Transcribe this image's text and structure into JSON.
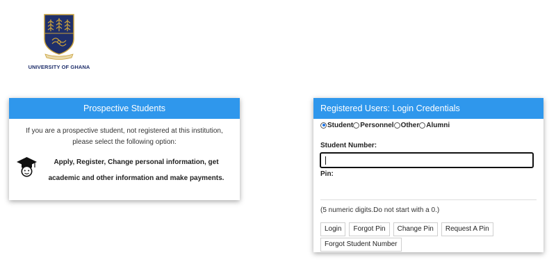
{
  "logo": {
    "university_name": "UNIVERSITY OF GHANA",
    "brand_navy": "#1f2f6b",
    "brand_gold": "#c9a13b"
  },
  "prospective": {
    "title": "Prospective Students",
    "intro": "If you are a prospective student, not registered at this institution, please select the following option:",
    "apply_text": "Apply, Register, Change personal information, get academic and other information and make payments.",
    "icon": "graduate-cap-icon"
  },
  "login": {
    "title": "Registered Users: Login Credentials",
    "user_types": [
      {
        "label": "Student",
        "checked": true
      },
      {
        "label": "Personnel",
        "checked": false
      },
      {
        "label": "Other",
        "checked": false
      },
      {
        "label": "Alumni",
        "checked": false
      }
    ],
    "student_number_label": "Student Number:",
    "student_number_value": "",
    "pin_label": "Pin:",
    "pin_value": "",
    "hint": "(5 numeric digits.Do not start with a 0.)",
    "buttons": {
      "login": "Login",
      "forgot_pin": "Forgot Pin",
      "change_pin": "Change Pin",
      "request_pin": "Request A Pin",
      "forgot_student_number": "Forgot Student Number"
    }
  },
  "colors": {
    "header_blue": "#2f97ec",
    "radio_selected": "#1a73e8"
  }
}
